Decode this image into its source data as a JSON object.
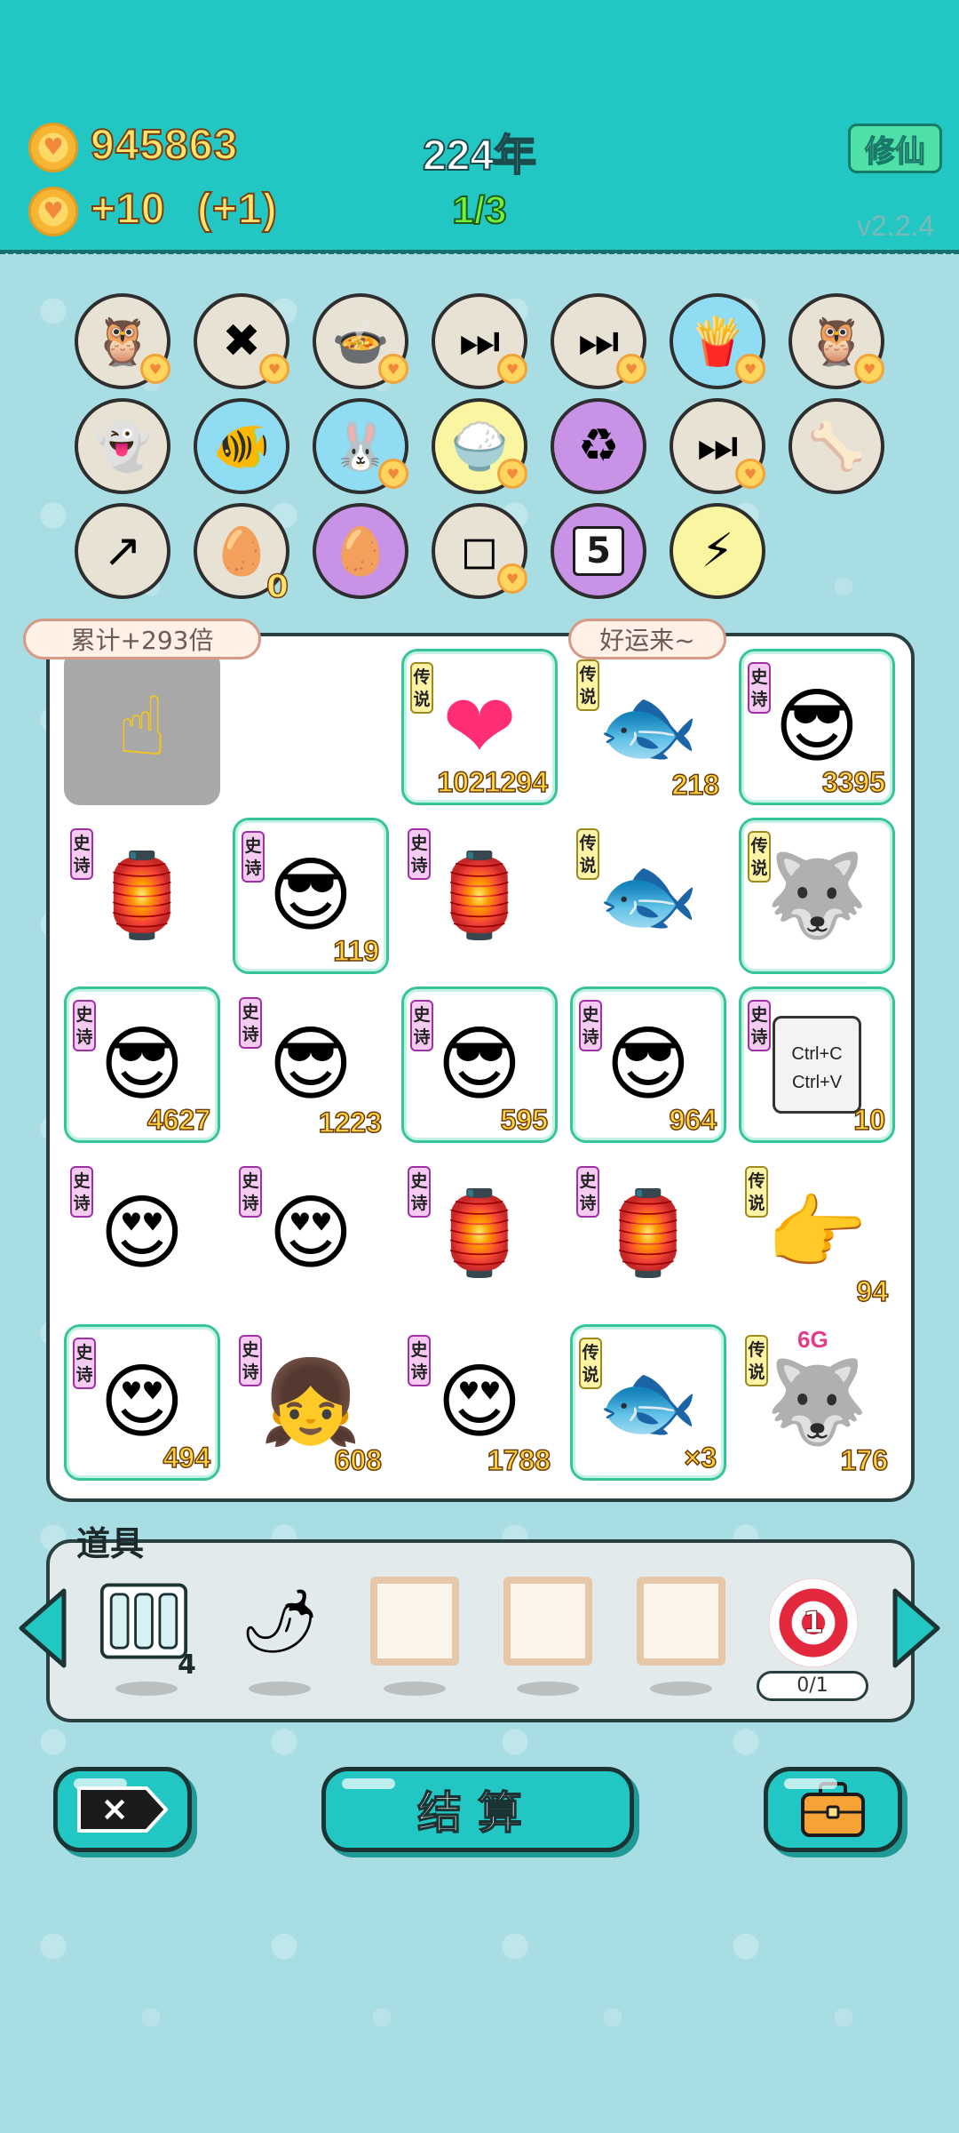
{
  "header": {
    "coins": "945863",
    "income": "+10",
    "income_bonus": "(+1)",
    "year": "224年",
    "stage": "1/3",
    "cultivate_button": "修仙",
    "version": "v2.2.4"
  },
  "skills": {
    "row1": [
      "owl",
      "delete-tag",
      "rice-cooker",
      "skip",
      "skip",
      "fries",
      "owl"
    ],
    "row2": [
      "ghost",
      "fishbowl",
      "rabbit",
      "rice-bowl",
      "recycle",
      "skip",
      "dog-bowl"
    ],
    "row3": [
      "upgrade-arrow",
      "egg-tray",
      "egg",
      "sugar-cubes",
      "calendar",
      "lightning"
    ],
    "egg_tray_count": "0",
    "calendar_day": "5"
  },
  "board": {
    "bubble_left": "累计+293倍",
    "bubble_right": "好运来~",
    "tag_epic": "史诗",
    "tag_legend": "传说",
    "cells": [
      {
        "icon": "☝",
        "tag": "",
        "num": "",
        "style": "gray"
      },
      {
        "icon": "",
        "tag": "",
        "num": "",
        "style": ""
      },
      {
        "icon": "❤",
        "tag": "legend",
        "num": "1021294",
        "style": "glow"
      },
      {
        "icon": "🐟",
        "tag": "legend",
        "num": "218",
        "style": ""
      },
      {
        "icon": "😎",
        "tag": "epic",
        "num": "3395",
        "style": "glow"
      },
      {
        "icon": "🏮",
        "tag": "epic",
        "num": "",
        "style": ""
      },
      {
        "icon": "😎",
        "tag": "epic",
        "num": "119",
        "style": "glow"
      },
      {
        "icon": "🏮",
        "tag": "epic",
        "num": "",
        "style": ""
      },
      {
        "icon": "🐟",
        "tag": "legend",
        "num": "",
        "style": ""
      },
      {
        "icon": "🐺",
        "tag": "legend",
        "num": "",
        "style": "glow"
      },
      {
        "icon": "😎",
        "tag": "epic",
        "num": "4627",
        "style": "glow"
      },
      {
        "icon": "😎",
        "tag": "epic",
        "num": "1223",
        "style": ""
      },
      {
        "icon": "😎",
        "tag": "epic",
        "num": "595",
        "style": "glow"
      },
      {
        "icon": "😎",
        "tag": "epic",
        "num": "964",
        "style": "glow"
      },
      {
        "icon": "📋",
        "tag": "epic",
        "num": "10",
        "style": "glow"
      },
      {
        "icon": "😍",
        "tag": "epic",
        "num": "",
        "style": ""
      },
      {
        "icon": "😍",
        "tag": "epic",
        "num": "",
        "style": ""
      },
      {
        "icon": "🏮",
        "tag": "epic",
        "num": "",
        "style": ""
      },
      {
        "icon": "🏮",
        "tag": "epic",
        "num": "",
        "style": ""
      },
      {
        "icon": "👉",
        "tag": "legend",
        "num": "94",
        "style": ""
      },
      {
        "icon": "😍",
        "tag": "epic",
        "num": "494",
        "style": "glow"
      },
      {
        "icon": "👧",
        "tag": "epic",
        "num": "608",
        "style": ""
      },
      {
        "icon": "😍",
        "tag": "epic",
        "num": "1788",
        "style": ""
      },
      {
        "icon": "🐟",
        "tag": "legend",
        "num": "×3",
        "style": "glow"
      },
      {
        "icon": "🐺",
        "tag": "legend",
        "num": "176",
        "style": ""
      }
    ],
    "ctrl_c": "Ctrl+C",
    "ctrl_v": "Ctrl+V",
    "six_g": "6G"
  },
  "props": {
    "label": "道具",
    "battery_count": "4",
    "target_number": "1",
    "target_progress": "0/1"
  },
  "buttons": {
    "settle": "结算"
  }
}
